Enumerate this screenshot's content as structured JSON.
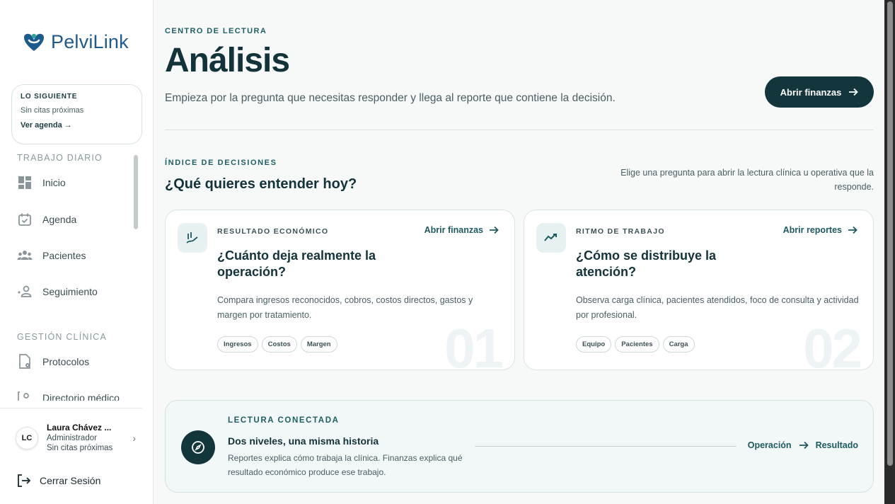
{
  "brand": {
    "name": "PelviLink",
    "color": "#1f5a8c",
    "accent": "#13363d"
  },
  "next": {
    "title": "LO SIGUIENTE",
    "subtitle": "Sin citas próximas",
    "link": "Ver agenda →"
  },
  "sidebar": {
    "sections": [
      {
        "label": "TRABAJO DIARIO",
        "items": [
          {
            "label": "Inicio",
            "icon": "dashboard-icon"
          },
          {
            "label": "Agenda",
            "icon": "calendar-check-icon"
          },
          {
            "label": "Pacientes",
            "icon": "users-icon"
          },
          {
            "label": "Seguimiento",
            "icon": "user-follow-icon"
          }
        ]
      },
      {
        "label": "GESTIÓN CLÍNICA",
        "items": [
          {
            "label": "Protocolos",
            "icon": "document-gear-icon"
          },
          {
            "label": "Directorio médico",
            "icon": "directory-icon"
          }
        ]
      }
    ]
  },
  "user": {
    "initials": "LC",
    "name": "Laura Chávez ...",
    "role": "Administrador",
    "status": "Sin citas próximas"
  },
  "logout": {
    "label": "Cerrar Sesión"
  },
  "header": {
    "eyebrow": "CENTRO DE LECTURA",
    "title": "Análisis",
    "subtitle": "Empieza por la pregunta que necesitas responder y llega al reporte que contiene la decisión.",
    "primary_button": "Abrir finanzas"
  },
  "index": {
    "eyebrow": "ÍNDICE DE DECISIONES",
    "title": "¿Qué quieres entender hoy?",
    "help": "Elige una pregunta para abrir la lectura clínica u operativa que la responde."
  },
  "cards": [
    {
      "category": "RESULTADO ECONÓMICO",
      "link": "Abrir finanzas",
      "question": "¿Cuánto deja realmente la operación?",
      "description": "Compara ingresos reconocidos, cobros, costos directos, gastos y margen por tratamiento.",
      "tags": [
        "Ingresos",
        "Costos",
        "Margen"
      ],
      "number": "01",
      "icon": "hand-chart-icon"
    },
    {
      "category": "RITMO DE TRABAJO",
      "link": "Abrir reportes",
      "question": "¿Cómo se distribuye la atención?",
      "description": "Observa carga clínica, pacientes atendidos, foco de consulta y actividad por profesional.",
      "tags": [
        "Equipo",
        "Pacientes",
        "Carga"
      ],
      "number": "02",
      "icon": "trend-line-icon"
    }
  ],
  "connected": {
    "eyebrow": "LECTURA CONECTADA",
    "title": "Dos niveles, una misma historia",
    "description": "Reportes explica cómo trabaja la clínica. Finanzas explica qué resultado económico produce ese trabajo.",
    "from": "Operación",
    "to": "Resultado",
    "icon": "compass-icon"
  }
}
